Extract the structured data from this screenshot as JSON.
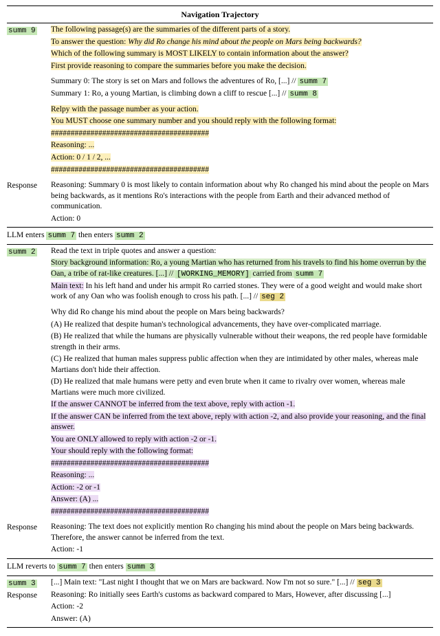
{
  "title": "Navigation Trajectory",
  "labels": {
    "response": "Response"
  },
  "tags": {
    "summ9": "summ 9",
    "summ8": "summ 8",
    "summ7": "summ 7",
    "summ3": "summ 3",
    "summ2": "summ 2",
    "seg2": "seg 2",
    "seg3": "seg 3",
    "wm": "[WORKING_MEMORY]"
  },
  "s9": {
    "intro1": "The following passage(s) are the summaries of the different parts of a story.",
    "intro2a": "To answer the question: ",
    "intro2q": "Why did Ro change his mind about the people on Mars being backwards?",
    "intro3": "Which of the following summary is MOST LIKELY to contain information about the answer?",
    "intro4": "First provide reasoning to compare the summaries before you make the decision.",
    "sum0": "Summary 0: The story is set on Mars and follows the adventures of Ro, [...] // ",
    "sum1": "Summary 1: Ro, a young Martian, is climbing down a cliff to rescue [...] // ",
    "instr1": "Relpy with the passage number as your action.",
    "instr2": "You MUST choose one summary number and you should reply with the following format:",
    "hash": "########################################",
    "fmtR": "Reasoning: ...",
    "fmtA": "Action: 0 / 1 / 2, ...",
    "respR": "Reasoning: Summary 0 is most likely to contain information about why Ro changed his mind about the people on Mars being backwards, as it mentions Ro's interactions with the people from Earth and their advanced method of communication.",
    "respA": "Action: 0"
  },
  "narr1a": "LLM enters ",
  "narr1b": " then enters ",
  "s2": {
    "p1": "Read the text in triple quotes and answer a question:",
    "bg1": "Story background information: Ro, a young Martian who has returned from his travels to find his home overrun by the Oan, a tribe of rat-like creatures. [...] // ",
    "bg2": " carried from ",
    "mt1a": "Main text:",
    "mt1b": " In his left hand and under his armpit Ro carried stones. They were of a good weight and would make short work of any Oan who was foolish enough to cross his path. [...] // ",
    "q": "Why did Ro change his mind about the people on Mars being backwards?",
    "A": "(A) He realized that despite human's technological advancements, they have over-complicated marriage.",
    "B": "(B) He realized that while the humans are physically vulnerable without their weapons, the red people have formidable strength in their arms.",
    "C": "(C) He realized that human males suppress public affection when they are intimidated by other males, whereas male Martians don't hide their affection.",
    "D": "(D) He realized that male humans were petty and even brute when it came to rivalry over women, whereas male Martians were much more civilized.",
    "i1": "If the answer CANNOT be inferred from the text above, reply with action -1.",
    "i2": "If the answer CAN be inferred from the text above, reply with action -2, and also provide your reasoning, and the final answer.",
    "i3": "You are ONLY allowed to reply with action -2 or -1.",
    "i4": "Your should reply with the following format:",
    "hash": "########################################",
    "fR": "Reasoning: ...",
    "fA": "Action: -2 or -1",
    "fAns": "Answer: (A) ...",
    "respR": "Reasoning: The text does not explicitly mention Ro changing his mind about the people on Mars being backwards. Therefore, the answer cannot be inferred from the text.",
    "respA": "Action: -1"
  },
  "narr2a": "LLM reverts to ",
  "narr2b": " then enters ",
  "s3": {
    "mt": "[...] Main text: \"Last night I thought that we on Mars are backward. Now I'm not so sure.\" [...] // ",
    "rR": "Reasoning: Ro initially sees Earth's customs as backward compared to Mars, However, after discussing [...]",
    "rA": "Action: -2",
    "rAns": "Answer: (A)"
  }
}
